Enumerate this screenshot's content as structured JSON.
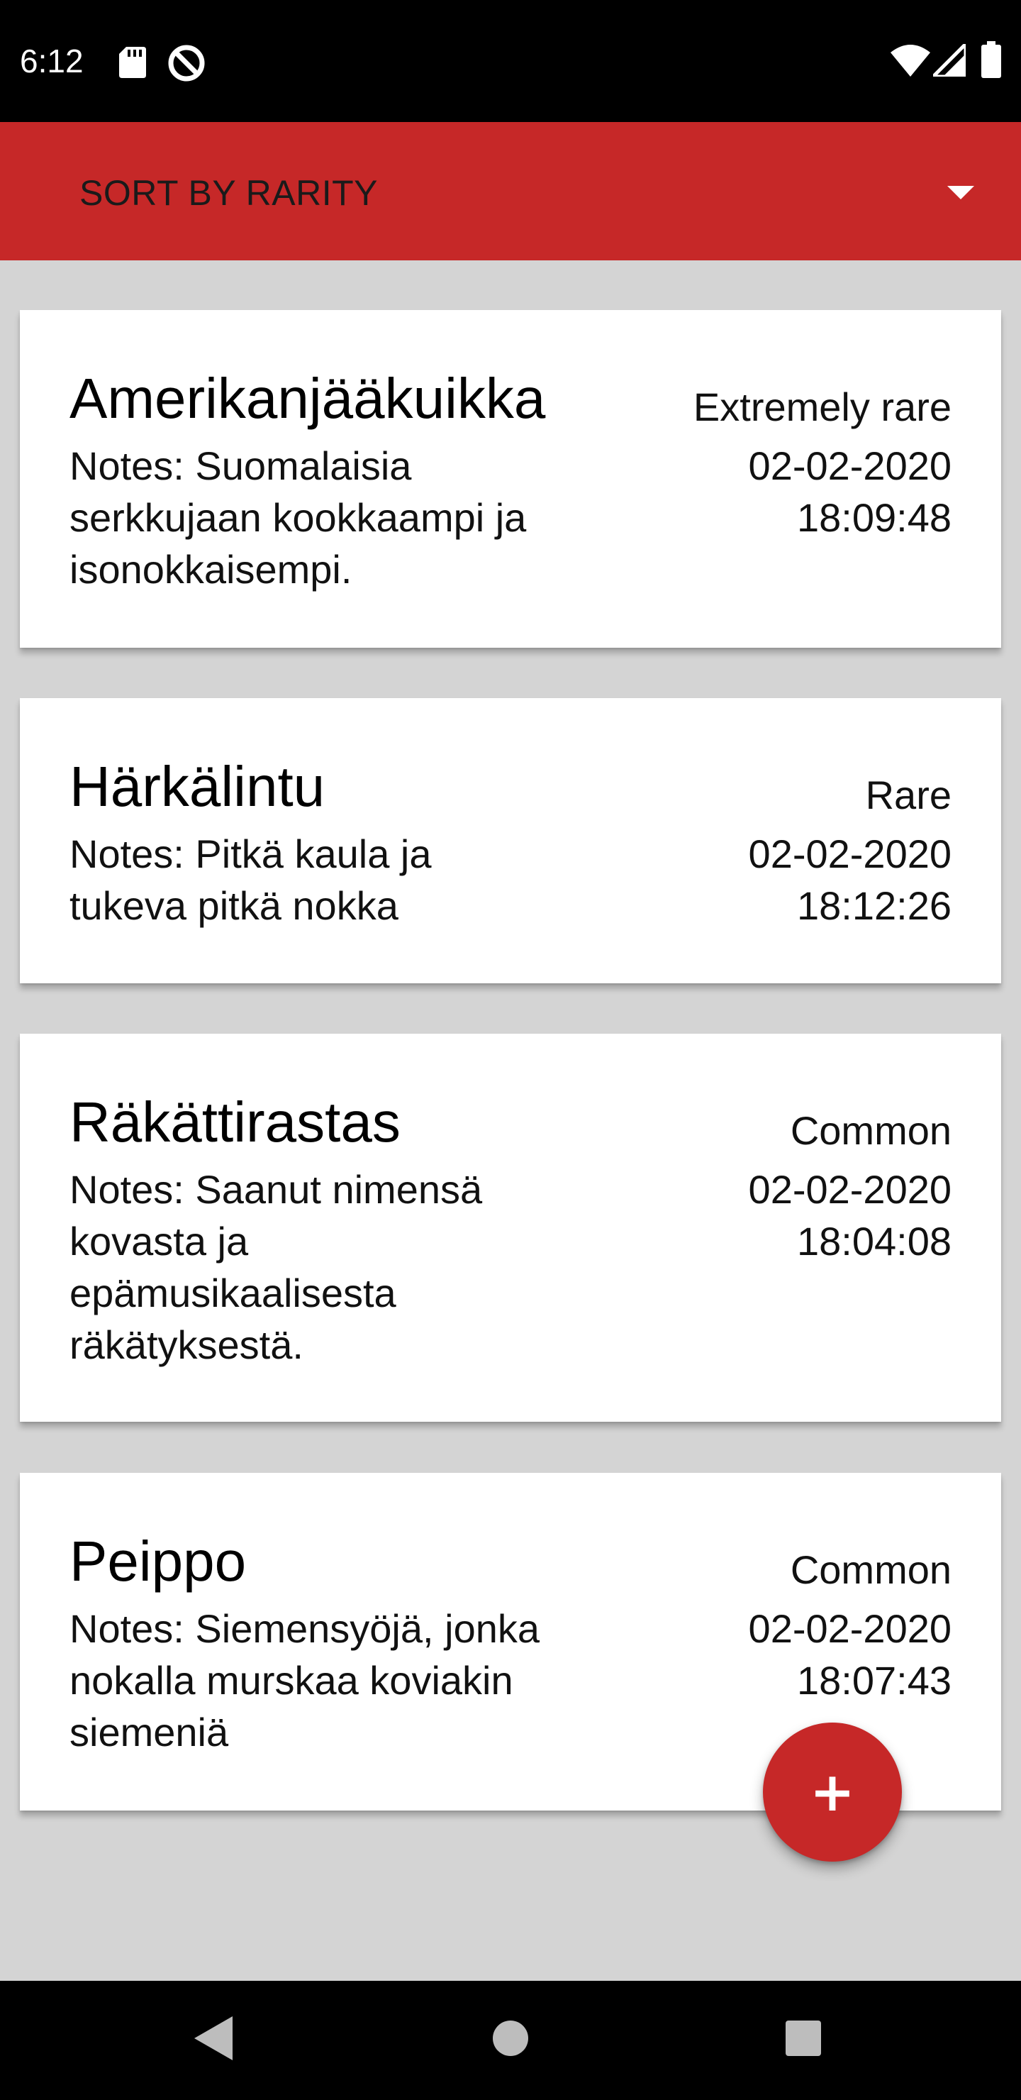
{
  "status_bar": {
    "time": "6:12",
    "icons_left": [
      "sd-card-icon",
      "do-not-disturb-icon"
    ],
    "icons_right": [
      "wifi-icon",
      "cell-signal-icon",
      "battery-icon"
    ]
  },
  "toolbar": {
    "sort_label": "SORT BY RARITY",
    "accent_color": "#c62828"
  },
  "birds": [
    {
      "name": "Amerikanjääkuikka",
      "notes": "Notes: Suomalaisia serkkujaan kookkaampi ja isonokkaisempi.",
      "rarity": "Extremely rare",
      "date": "02-02-2020",
      "time": "18:09:48"
    },
    {
      "name": "Härkälintu",
      "notes": "Notes: Pitkä kaula ja tukeva pitkä nokka",
      "rarity": "Rare",
      "date": "02-02-2020",
      "time": "18:12:26"
    },
    {
      "name": "Räkättirastas",
      "notes": "Notes: Saanut nimensä kovasta ja epämusikaalisesta räkätyksestä.",
      "rarity": "Common",
      "date": "02-02-2020",
      "time": "18:04:08"
    },
    {
      "name": "Peippo",
      "notes": "Notes: Siemensyöjä, jonka nokalla murskaa koviakin siemeniä",
      "rarity": "Common",
      "date": "02-02-2020",
      "time": "18:07:43"
    }
  ],
  "fab": {
    "label": "+",
    "icon": "plus-icon"
  },
  "nav_bar": {
    "buttons": [
      "back-icon",
      "home-icon",
      "recents-icon"
    ]
  }
}
